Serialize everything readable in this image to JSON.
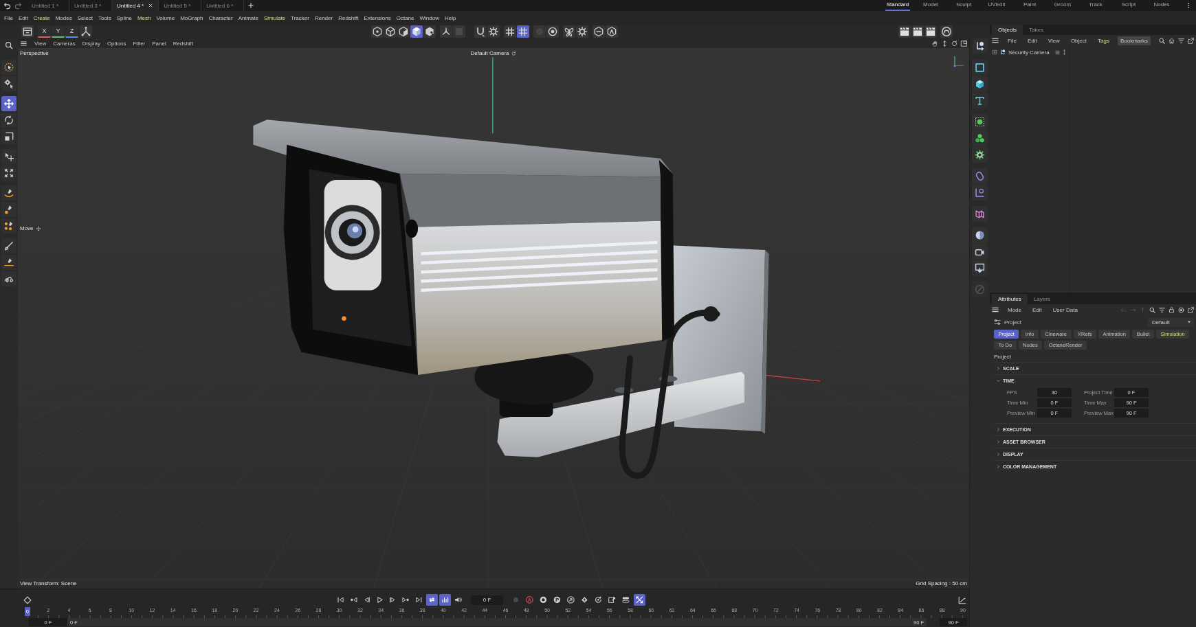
{
  "title_bar": {
    "document_tabs": [
      {
        "label": "Untitled 1 *",
        "selected": false
      },
      {
        "label": "Untitled 3 *",
        "selected": false
      },
      {
        "label": "Untitled 4 *",
        "selected": true
      },
      {
        "label": "Untitled 5 *",
        "selected": false
      },
      {
        "label": "Untitled 6 *",
        "selected": false
      }
    ],
    "layouts": [
      {
        "label": "Standard",
        "selected": true
      },
      {
        "label": "Model",
        "selected": false
      },
      {
        "label": "Sculpt",
        "selected": false
      },
      {
        "label": "UVEdit",
        "selected": false
      },
      {
        "label": "Paint",
        "selected": false
      },
      {
        "label": "Groom",
        "selected": false
      },
      {
        "label": "Track",
        "selected": false
      },
      {
        "label": "Script",
        "selected": false
      },
      {
        "label": "Nodes",
        "selected": false
      }
    ]
  },
  "menu_bar": [
    {
      "label": "File",
      "highlighted": false
    },
    {
      "label": "Edit",
      "highlighted": false
    },
    {
      "label": "Create",
      "highlighted": true
    },
    {
      "label": "Modes",
      "highlighted": false
    },
    {
      "label": "Select",
      "highlighted": false
    },
    {
      "label": "Tools",
      "highlighted": false
    },
    {
      "label": "Spline",
      "highlighted": false
    },
    {
      "label": "Mesh",
      "highlighted": true
    },
    {
      "label": "Volume",
      "highlighted": false
    },
    {
      "label": "MoGraph",
      "highlighted": false
    },
    {
      "label": "Character",
      "highlighted": false
    },
    {
      "label": "Animate",
      "highlighted": false
    },
    {
      "label": "Simulate",
      "highlighted": true
    },
    {
      "label": "Tracker",
      "highlighted": false
    },
    {
      "label": "Render",
      "highlighted": false
    },
    {
      "label": "Redshift",
      "highlighted": false
    },
    {
      "label": "Extensions",
      "highlighted": false
    },
    {
      "label": "Octane",
      "highlighted": false
    },
    {
      "label": "Window",
      "highlighted": false
    },
    {
      "label": "Help",
      "highlighted": false
    }
  ],
  "toolbar": {
    "axis_locks": [
      {
        "label": "X",
        "color": "#e05c5c"
      },
      {
        "label": "Y",
        "color": "#63c463"
      },
      {
        "label": "Z",
        "color": "#5b8fe6"
      }
    ],
    "mode_buttons": [
      {
        "selected": false
      },
      {
        "selected": false
      },
      {
        "selected": false
      },
      {
        "selected": true
      },
      {
        "selected": false
      }
    ],
    "snap_buttons": [
      {
        "selected": false
      },
      {
        "selected": true
      }
    ]
  },
  "tool_palette": [
    {
      "selected": false
    },
    {
      "selected": false
    },
    {
      "selected": true
    },
    {
      "selected": false
    },
    {
      "selected": false
    },
    {
      "selected": false
    },
    {
      "selected": false
    },
    {
      "selected": false
    },
    {
      "selected": false
    },
    {
      "selected": false
    },
    {
      "selected": false
    },
    {
      "selected": false
    },
    {
      "selected": false
    }
  ],
  "viewport": {
    "menu": [
      "View",
      "Cameras",
      "Display",
      "Options",
      "Filter",
      "Panel",
      "Redshift"
    ],
    "view_name": "Perspective",
    "camera": "Default Camera",
    "tool": "Move",
    "view_transform": "View Transform: Scene",
    "grid_spacing": "Grid Spacing : 50 cm"
  },
  "objects_panel": {
    "tabs": [
      {
        "label": "Objects",
        "selected": true
      },
      {
        "label": "Takes",
        "selected": false
      }
    ],
    "menu": [
      {
        "label": "File",
        "highlighted": false,
        "pressed": false
      },
      {
        "label": "Edit",
        "highlighted": false,
        "pressed": false
      },
      {
        "label": "View",
        "highlighted": false,
        "pressed": false
      },
      {
        "label": "Object",
        "highlighted": false,
        "pressed": false
      },
      {
        "label": "Tags",
        "highlighted": true,
        "pressed": false
      },
      {
        "label": "Bookmarks",
        "highlighted": false,
        "pressed": true
      }
    ],
    "objects": [
      {
        "name": "Security Camera",
        "expanded": false,
        "enabled": true
      }
    ]
  },
  "attributes_panel": {
    "tabs": [
      {
        "label": "Attributes",
        "selected": true
      },
      {
        "label": "Layers",
        "selected": false
      }
    ],
    "menu": [
      "Mode",
      "Edit",
      "User Data"
    ],
    "object": "Project",
    "preset": "Default",
    "pages": [
      {
        "label": "Project",
        "selected": true,
        "highlighted": false
      },
      {
        "label": "Info",
        "selected": false,
        "highlighted": false
      },
      {
        "label": "Cineware",
        "selected": false,
        "highlighted": false
      },
      {
        "label": "XRefs",
        "selected": false,
        "highlighted": false
      },
      {
        "label": "Animation",
        "selected": false,
        "highlighted": false
      },
      {
        "label": "Bullet",
        "selected": false,
        "highlighted": false
      },
      {
        "label": "Simulation",
        "selected": false,
        "highlighted": true
      },
      {
        "label": "To Do",
        "selected": false,
        "highlighted": false
      },
      {
        "label": "Nodes",
        "selected": false,
        "highlighted": false
      },
      {
        "label": "OctaneRender",
        "selected": false,
        "highlighted": false
      }
    ],
    "section": "Project",
    "groups": [
      {
        "title": "SCALE",
        "expanded": false
      },
      {
        "title": "TIME",
        "expanded": true,
        "fields": [
          {
            "label": "FPS",
            "value": "30"
          },
          {
            "label": "Project Time",
            "value": "0 F"
          },
          {
            "label": "Time Min",
            "value": "0 F"
          },
          {
            "label": "Time Max",
            "value": "90 F"
          },
          {
            "label": "Preview Min",
            "value": "0 F"
          },
          {
            "label": "Preview Max",
            "value": "90 F"
          }
        ]
      },
      {
        "title": "EXECUTION",
        "expanded": false
      },
      {
        "title": "ASSET BROWSER",
        "expanded": false
      },
      {
        "title": "DISPLAY",
        "expanded": false
      },
      {
        "title": "COLOR MANAGEMENT",
        "expanded": false
      }
    ]
  },
  "timeline": {
    "transport_buttons": [
      {
        "selected": false
      },
      {
        "selected": false
      },
      {
        "selected": false
      },
      {
        "selected": false
      },
      {
        "selected": false
      },
      {
        "selected": false
      },
      {
        "selected": false
      },
      {
        "selected": true
      },
      {
        "selected": true
      },
      {
        "selected": false
      }
    ],
    "current_frame": "0 F",
    "key_buttons": [
      {
        "selected": false
      },
      {
        "selected": false
      },
      {
        "selected": false
      },
      {
        "selected": false
      },
      {
        "selected": false
      },
      {
        "selected": false
      },
      {
        "selected": false
      },
      {
        "selected": false
      },
      {
        "selected": false
      },
      {
        "selected": true
      }
    ],
    "playhead": {
      "label": "0",
      "level": 0
    },
    "ruler_labels": [
      "2",
      "4",
      "6",
      "8",
      "10",
      "12",
      "14",
      "16",
      "18",
      "20",
      "22",
      "24",
      "26",
      "28",
      "30",
      "32",
      "34",
      "36",
      "38",
      "40",
      "42",
      "44",
      "46",
      "48",
      "50",
      "52",
      "54",
      "56",
      "58",
      "60",
      "62",
      "64",
      "66",
      "68",
      "70",
      "72",
      "74",
      "76",
      "78",
      "80",
      "82",
      "84",
      "86",
      "88",
      "90"
    ],
    "start_frame": "0 F",
    "preview_start": "0 F",
    "preview_end": "90 F",
    "end_frame": "90 F"
  }
}
